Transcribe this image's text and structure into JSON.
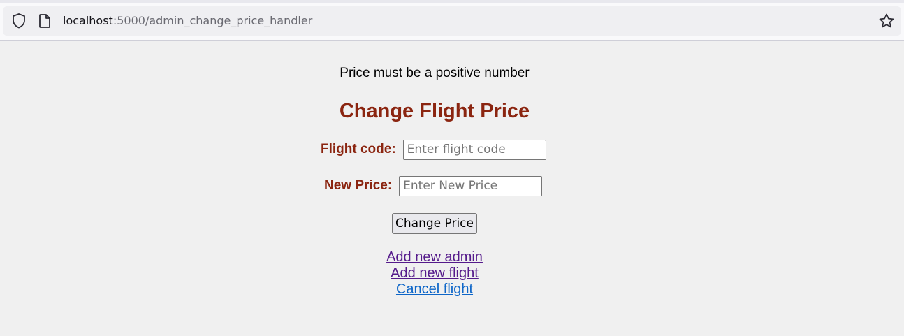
{
  "browser": {
    "url_host": "localhost",
    "url_path": ":5000/admin_change_price_handler",
    "icons": [
      "shield-icon",
      "page-icon",
      "star-icon"
    ]
  },
  "page": {
    "message": "Price must be a positive number",
    "title": "Change Flight Price",
    "form": {
      "flight_code_label": "Flight code:",
      "flight_code_placeholder": "Enter flight code",
      "flight_code_value": "",
      "new_price_label": "New Price:",
      "new_price_placeholder": "Enter New Price",
      "new_price_value": "",
      "submit_label": "Change Price"
    },
    "links": [
      {
        "label": "Add new admin",
        "visited": true
      },
      {
        "label": "Add new flight",
        "visited": true
      },
      {
        "label": "Cancel flight",
        "visited": false
      }
    ]
  },
  "colors": {
    "heading": "#8b2510",
    "visited_link": "#551a8b",
    "link": "#0e66c8",
    "background": "#f0f0f0"
  }
}
